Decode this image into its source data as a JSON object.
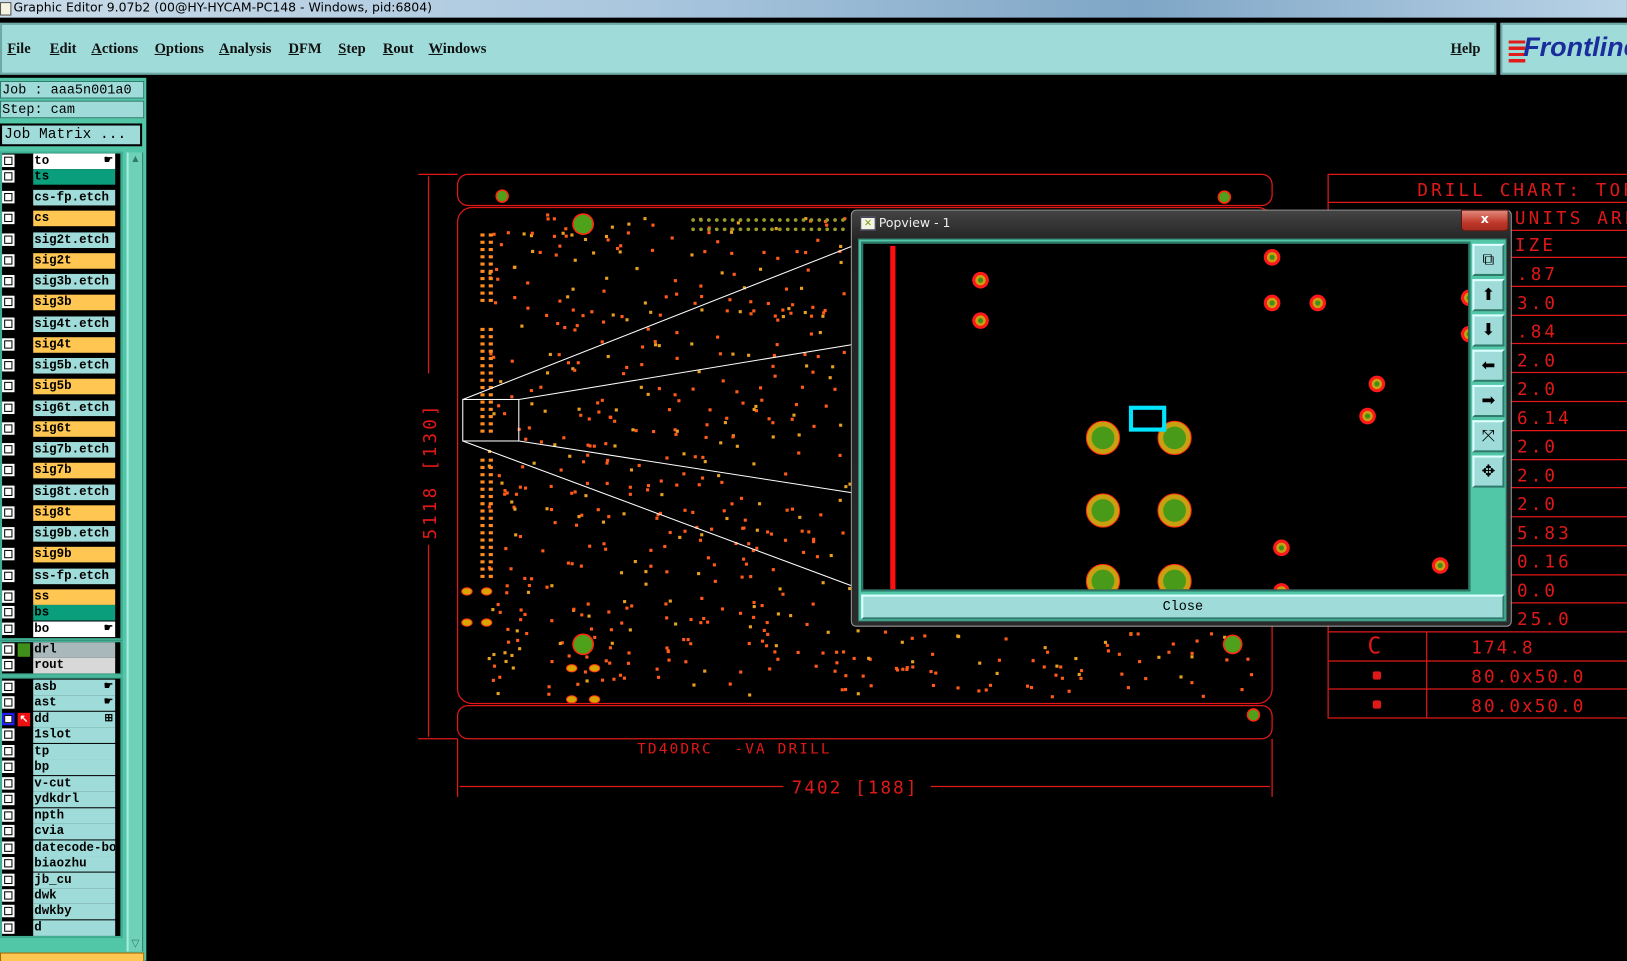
{
  "window": {
    "title": "Graphic Editor 9.07b2 (00@HY-HYCAM-PC148 - Windows, pid:6804)"
  },
  "menu": {
    "items": [
      "File",
      "Edit",
      "Actions",
      "Options",
      "Analysis",
      "DFM",
      "Step",
      "Rout",
      "Windows"
    ],
    "help": "Help"
  },
  "logo": {
    "text": "Frontline"
  },
  "left_panel": {
    "job": "Job : aaa5n001a0",
    "step": "Step: cam",
    "job_matrix": "Job Matrix ...",
    "layers": [
      {
        "name": "to",
        "type": "board",
        "color": "#ffffff",
        "marker": "pointer"
      },
      {
        "name": "ts",
        "type": "solder",
        "color": "#0a9e7c"
      },
      {
        "name": "cs-fp.etch",
        "type": "etch",
        "color": "#9fdcd9"
      },
      {
        "name": "cs",
        "type": "signal",
        "color": "#ffc652"
      },
      {
        "name": "sig2t.etch",
        "type": "etch",
        "color": "#9fdcd9"
      },
      {
        "name": "sig2t",
        "type": "signal",
        "color": "#ffc652"
      },
      {
        "name": "sig3b.etch",
        "type": "etch",
        "color": "#9fdcd9"
      },
      {
        "name": "sig3b",
        "type": "signal",
        "color": "#ffc652"
      },
      {
        "name": "sig4t.etch",
        "type": "etch",
        "color": "#9fdcd9"
      },
      {
        "name": "sig4t",
        "type": "signal",
        "color": "#ffc652"
      },
      {
        "name": "sig5b.etch",
        "type": "etch",
        "color": "#9fdcd9"
      },
      {
        "name": "sig5b",
        "type": "signal",
        "color": "#ffc652"
      },
      {
        "name": "sig6t.etch",
        "type": "etch",
        "color": "#9fdcd9"
      },
      {
        "name": "sig6t",
        "type": "signal",
        "color": "#ffc652"
      },
      {
        "name": "sig7b.etch",
        "type": "etch",
        "color": "#9fdcd9"
      },
      {
        "name": "sig7b",
        "type": "signal",
        "color": "#ffc652"
      },
      {
        "name": "sig8t.etch",
        "type": "etch",
        "color": "#9fdcd9"
      },
      {
        "name": "sig8t",
        "type": "signal",
        "color": "#ffc652"
      },
      {
        "name": "sig9b.etch",
        "type": "etch",
        "color": "#9fdcd9"
      },
      {
        "name": "sig9b",
        "type": "signal",
        "color": "#ffc652"
      },
      {
        "name": "ss-fp.etch",
        "type": "etch",
        "color": "#9fdcd9"
      },
      {
        "name": "ss",
        "type": "signal",
        "color": "#ffc652"
      },
      {
        "name": "bs",
        "type": "solder",
        "color": "#0a9e7c"
      },
      {
        "name": "bo",
        "type": "board",
        "color": "#ffffff",
        "marker": "pointer"
      },
      {
        "name": "drl",
        "type": "drill",
        "color": "#a9b8bb",
        "active": true,
        "swatch": "#3f8f1a"
      },
      {
        "name": "rout",
        "type": "rout",
        "color": "#d8d8d8"
      },
      {
        "name": "asb",
        "type": "misc",
        "color": "#9fdcd9",
        "marker": "pointer"
      },
      {
        "name": "ast",
        "type": "misc",
        "color": "#9fdcd9",
        "marker": "pointer"
      },
      {
        "name": "dd",
        "type": "misc",
        "color": "#9fdcd9",
        "marker": "grid",
        "work_layer": true
      },
      {
        "name": "1slot",
        "type": "misc",
        "color": "#9fdcd9"
      },
      {
        "name": "tp",
        "type": "misc",
        "color": "#9fdcd9"
      },
      {
        "name": "bp",
        "type": "misc",
        "color": "#9fdcd9"
      },
      {
        "name": "v-cut",
        "type": "misc",
        "color": "#9fdcd9"
      },
      {
        "name": "ydkdrl",
        "type": "misc",
        "color": "#9fdcd9"
      },
      {
        "name": "npth",
        "type": "misc",
        "color": "#9fdcd9"
      },
      {
        "name": "cvia",
        "type": "misc",
        "color": "#9fdcd9"
      },
      {
        "name": "datecode-bo",
        "type": "misc",
        "color": "#9fdcd9"
      },
      {
        "name": "biaozhu",
        "type": "misc",
        "color": "#9fdcd9"
      },
      {
        "name": "jb_cu",
        "type": "misc",
        "color": "#9fdcd9"
      },
      {
        "name": "dwk",
        "type": "misc",
        "color": "#9fdcd9"
      },
      {
        "name": "dwkby",
        "type": "misc",
        "color": "#9fdcd9"
      },
      {
        "name": "d",
        "type": "misc",
        "color": "#9fdcd9"
      }
    ]
  },
  "canvas": {
    "height_dimension": "5118 [130]",
    "width_dimension": "7402 [188]",
    "drill_label": "TD40DRC  -VA DRILL",
    "drill_chart": {
      "title": "DRILL CHART: TOP",
      "units": "UNITS ARE",
      "size_header": "IZE",
      "values": [
        ".87",
        "3.0",
        ".84",
        "2.0",
        "2.0",
        "6.14",
        "2.0",
        "2.0",
        "2.0",
        "5.83",
        "0.16",
        "0.0",
        "25.0"
      ],
      "full_rows": [
        {
          "symbol": "C",
          "size": "174.8"
        },
        {
          "symbol": "slot",
          "size": "80.0x50.0"
        },
        {
          "symbol": "slot",
          "size": "80.0x50.0"
        }
      ]
    }
  },
  "popview": {
    "title": "Popview - 1",
    "close_x": "x",
    "close_button": "Close",
    "tools": [
      "zoom-window",
      "pan-up",
      "pan-down",
      "pan-left",
      "pan-right",
      "zoom-in",
      "zoom-out"
    ]
  },
  "colors": {
    "accent": "#9fdcd9",
    "panel": "#52c7a8",
    "signal": "#ffc652",
    "drawing": "#e01818",
    "pad_outer": "#ff1a1a",
    "pad_inner": "#3f8f1a",
    "highlight": "#00e5ff"
  }
}
